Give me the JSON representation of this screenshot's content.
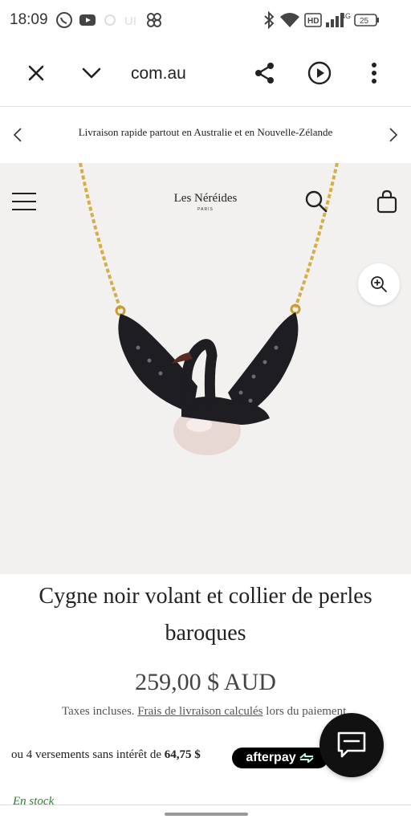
{
  "status_bar": {
    "time": "18:09",
    "battery": "25",
    "network": "4G",
    "hd": "HD"
  },
  "browser": {
    "url": "com.au"
  },
  "announcement": {
    "text": "Livraison rapide partout en Australie et en Nouvelle-Zélande"
  },
  "store": {
    "logo": "Les Néréides",
    "logo_sub": "PARIS"
  },
  "product": {
    "title": "Cygne noir volant et collier de perles baroques",
    "price": "259,00 $ AUD",
    "tax_prefix": "Taxes incluses.",
    "tax_link": "Frais de livraison calculés",
    "tax_suffix": "lors du paiement.",
    "installments_prefix": "ou 4 versements sans intérêt de",
    "installment_amount": "64,75 $",
    "afterpay_label": "afterpay",
    "stock": "En stock"
  },
  "colors": {
    "accent_black": "#111111",
    "hero_bg": "#f2f1f0",
    "stock_green": "#2e7d32"
  }
}
